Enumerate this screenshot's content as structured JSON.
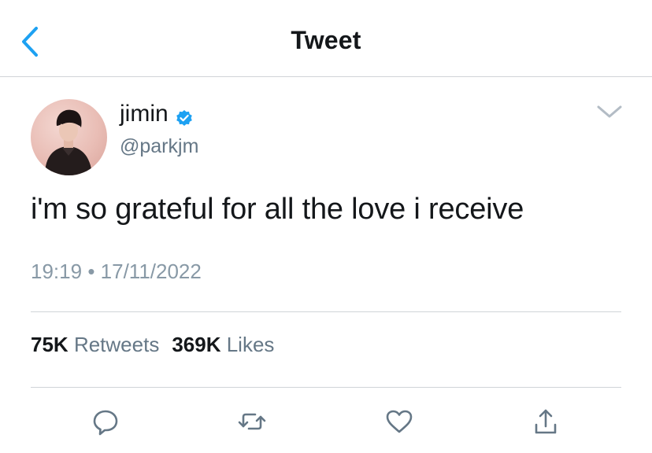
{
  "header": {
    "title": "Tweet",
    "back_icon": "chevron-left-icon"
  },
  "colors": {
    "accent": "#1DA1F2",
    "text": "#14171A",
    "secondary": "#657786",
    "divider": "#D0D4D8"
  },
  "tweet": {
    "author_name": "jimin",
    "author_handle": "@parkjm",
    "verified": true,
    "text": "i'm so grateful for all the love i receive",
    "time": "19:19",
    "separator": "•",
    "date": "17/11/2022",
    "retweets_count": "75K",
    "retweets_label": "Retweets",
    "likes_count": "369K",
    "likes_label": "Likes"
  },
  "actions": [
    {
      "name": "reply",
      "icon": "comment-icon"
    },
    {
      "name": "retweet",
      "icon": "retweet-icon"
    },
    {
      "name": "like",
      "icon": "heart-icon"
    },
    {
      "name": "share",
      "icon": "share-icon"
    }
  ]
}
